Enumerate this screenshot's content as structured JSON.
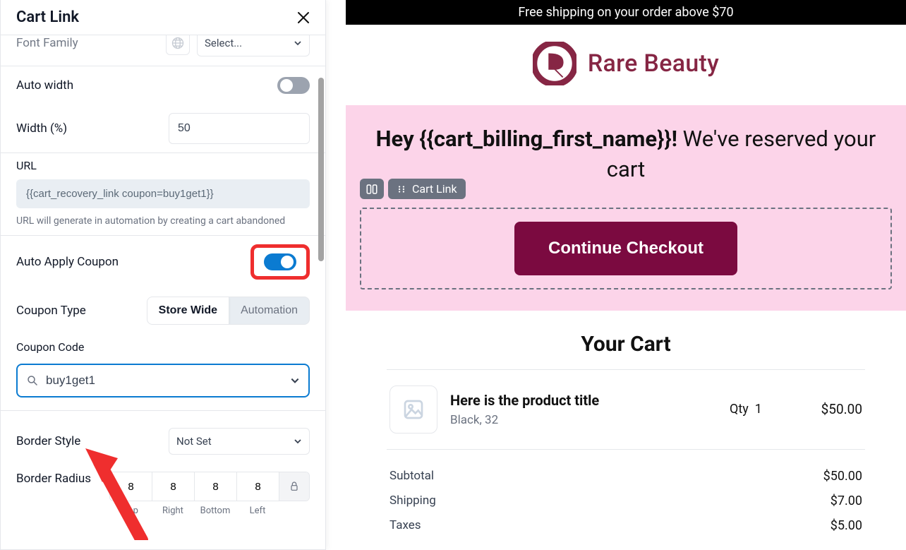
{
  "panel": {
    "title": "Cart Link",
    "font_family_label": "Font Family",
    "font_family_value": "Select...",
    "auto_width_label": "Auto width",
    "auto_width_on": false,
    "width_label": "Width (%)",
    "width_value": "50",
    "url_label": "URL",
    "url_value": "{{cart_recovery_link coupon=buy1get1}}",
    "url_help": "URL will generate in automation by creating a cart abandoned",
    "auto_apply_label": "Auto Apply Coupon",
    "auto_apply_on": true,
    "coupon_type_label": "Coupon Type",
    "coupon_type_options": [
      "Store Wide",
      "Automation"
    ],
    "coupon_type_selected": "Store Wide",
    "coupon_code_label": "Coupon Code",
    "coupon_code_value": "buy1get1",
    "border_style_label": "Border Style",
    "border_style_value": "Not Set",
    "border_radius_label": "Border Radius",
    "border_radius_values": [
      "8",
      "8",
      "8",
      "8"
    ],
    "border_radius_side_labels": [
      "Top",
      "Right",
      "Bottom",
      "Left"
    ]
  },
  "preview": {
    "banner_text": "Free shipping on your order above $70",
    "brand_name": "Rare Beauty",
    "hero_greeting_prefix": "Hey ",
    "hero_greeting_var": "{{cart_billing_first_name}}!",
    "hero_greeting_suffix": " We've reserved your cart",
    "pill_cartlink": "Cart Link",
    "cta_label": "Continue Checkout",
    "cart_title": "Your Cart",
    "product": {
      "title": "Here is the product title",
      "variant": "Black, 32",
      "qty_label": "Qty",
      "qty_value": "1",
      "price": "$50.00"
    },
    "totals": [
      {
        "label": "Subtotal",
        "value": "$50.00"
      },
      {
        "label": "Shipping",
        "value": "$7.00"
      },
      {
        "label": "Taxes",
        "value": "$5.00"
      }
    ]
  }
}
